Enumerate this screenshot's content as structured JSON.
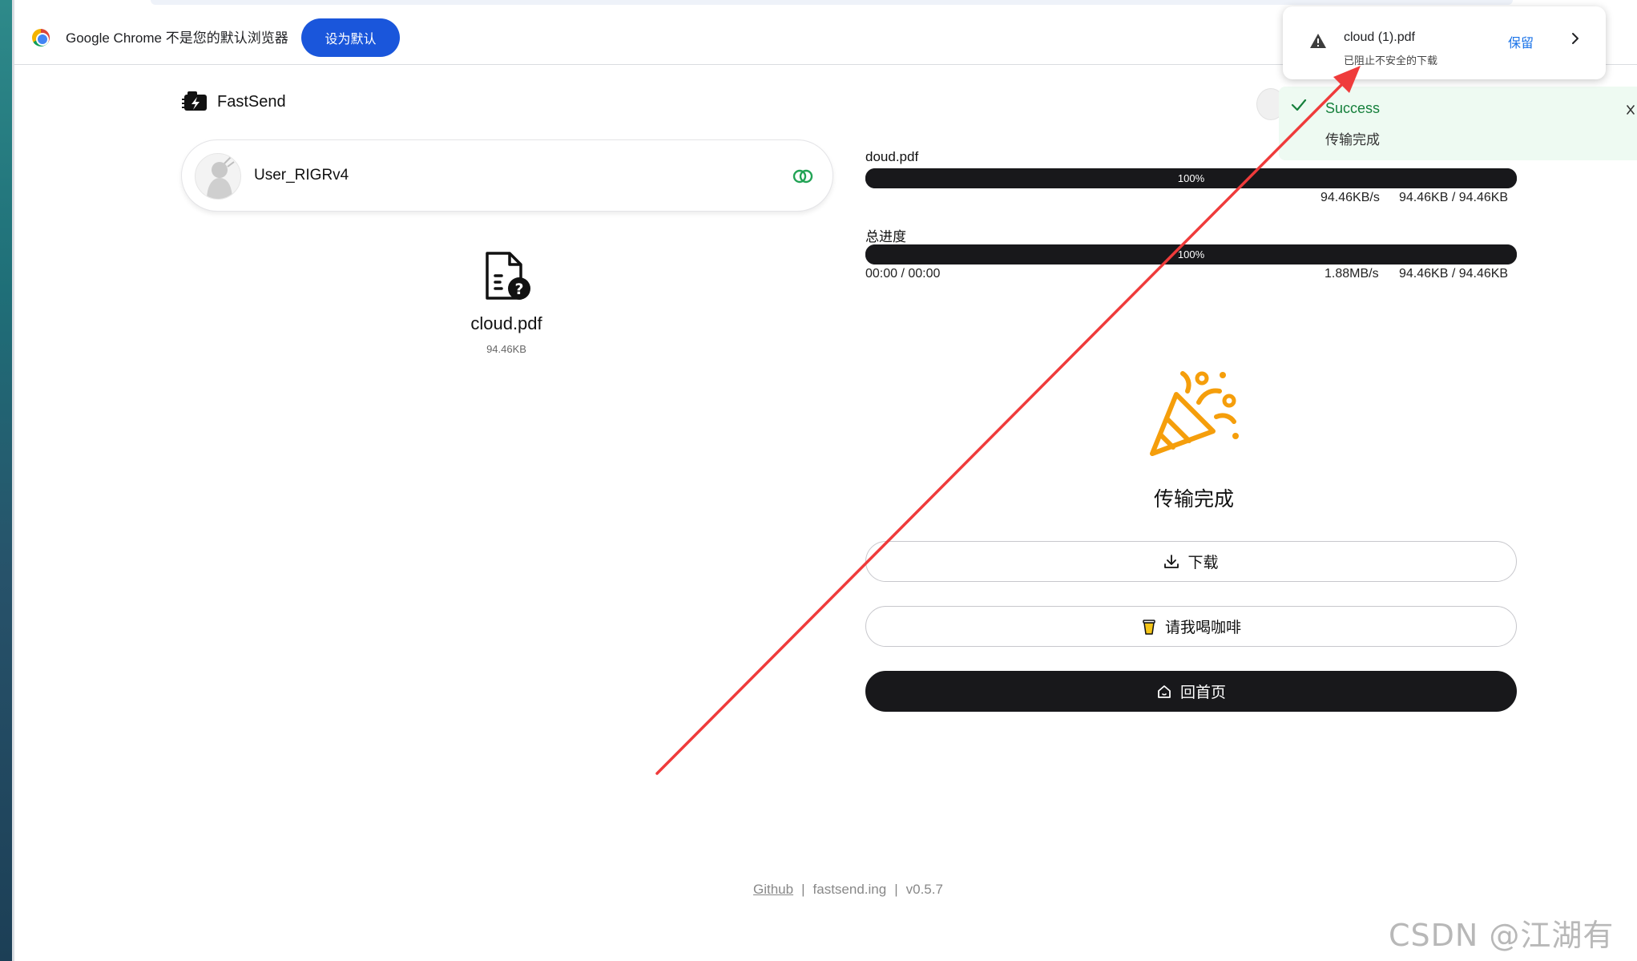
{
  "infobar": {
    "message": "Google Chrome 不是您的默认浏览器",
    "set_default_label": "设为默认"
  },
  "app": {
    "brand": "FastSend"
  },
  "user": {
    "name": "User_RIGRv4"
  },
  "file": {
    "name": "cloud.pdf",
    "size": "94.46KB"
  },
  "progress": {
    "file": {
      "label": "doud.pdf",
      "percent_text": "100%",
      "fraction": 1.0,
      "speed": "94.46KB/s",
      "transferred": "94.46KB / 94.46KB"
    },
    "total": {
      "label": "总进度",
      "percent_text": "100%",
      "fraction": 1.0,
      "time": "00:00 / 00:00",
      "speed": "1.88MB/s",
      "transferred": "94.46KB / 94.46KB"
    }
  },
  "complete": {
    "title": "传输完成",
    "download_label": "下载",
    "coffee_label": "请我喝咖啡",
    "home_label": "回首页"
  },
  "footer": {
    "github": "Github",
    "site": "fastsend.ing",
    "version": "v0.5.7"
  },
  "download_popup": {
    "filename": "cloud (1).pdf",
    "subtitle": "已阻止不安全的下载",
    "keep_label": "保留"
  },
  "toast": {
    "title": "Success",
    "message": "传输完成"
  },
  "watermark": "CSDN @江湖有缘",
  "colors": {
    "accent_blue": "#1a56db",
    "success_green": "#16803c",
    "dark": "#18181b",
    "arrow_red": "#ef3b3b"
  }
}
